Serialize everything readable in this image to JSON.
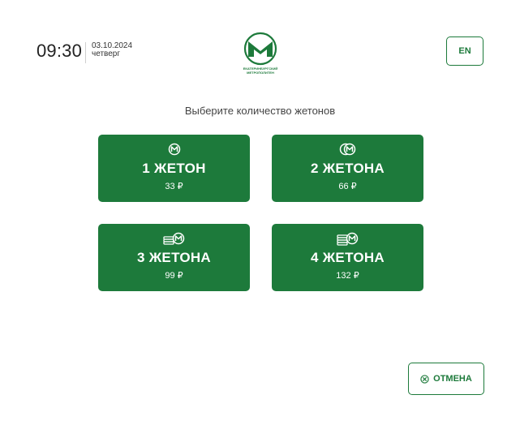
{
  "header": {
    "time": "09:30",
    "date": "03.10.2024",
    "weekday": "четверг",
    "logo_text_line1": "ЕКАТЕРИНБУРГСКИЙ",
    "logo_text_line2": "МЕТРОПОЛИТЕН",
    "lang_button": "EN"
  },
  "prompt": "Выберите количество жетонов",
  "options": [
    {
      "title": "1 ЖЕТОН",
      "price": "33 ₽",
      "icon": "single-token-icon"
    },
    {
      "title": "2 ЖЕТОНА",
      "price": "66 ₽",
      "icon": "double-token-icon"
    },
    {
      "title": "3 ЖЕТОНА",
      "price": "99 ₽",
      "icon": "token-stack-icon"
    },
    {
      "title": "4 ЖЕТОНА",
      "price": "132 ₽",
      "icon": "token-stack-icon"
    }
  ],
  "cancel_label": "ОТМЕНА",
  "colors": {
    "brand": "#1d7a3b",
    "background": "#ffffff"
  }
}
